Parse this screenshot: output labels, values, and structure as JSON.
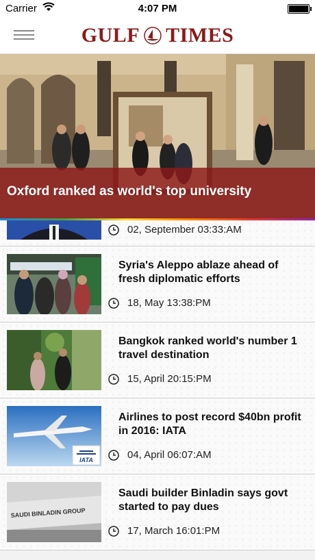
{
  "status": {
    "carrier": "Carrier",
    "time": "4:07 PM"
  },
  "header": {
    "logo_left": "GULF",
    "logo_right": "TIMES"
  },
  "hero": {
    "caption": "Oxford ranked as world's top university"
  },
  "articles": [
    {
      "title": "",
      "date": "02, September 03:33:AM"
    },
    {
      "title": "Syria's Aleppo ablaze ahead of fresh diplomatic efforts",
      "date": "18, May 13:38:PM"
    },
    {
      "title": "Bangkok ranked world's number 1 travel destination",
      "date": "15, April 20:15:PM"
    },
    {
      "title": "Airlines to post record $40bn profit in 2016: IATA",
      "date": "04, April 06:07:AM"
    },
    {
      "title": "Saudi builder Binladin says govt started to pay dues",
      "date": "17, March 16:01:PM"
    }
  ],
  "thumbnail_texts": {
    "iata": "IATA",
    "binladin": "SAUDI BINLADIN GROUP"
  }
}
